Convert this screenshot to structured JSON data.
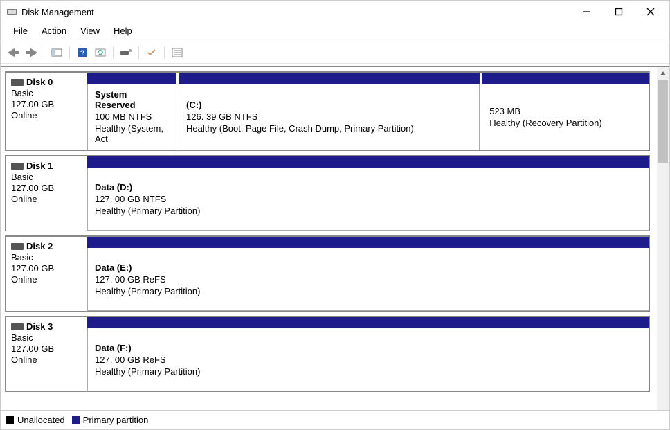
{
  "window": {
    "title": "Disk Management"
  },
  "menu": {
    "file": "File",
    "action": "Action",
    "view": "View",
    "help": "Help"
  },
  "legend": {
    "unallocated": "Unallocated",
    "primary": "Primary partition"
  },
  "disks": [
    {
      "name": "Disk 0",
      "type": "Basic",
      "size": "127.00 GB",
      "status": "Online",
      "partitions": [
        {
          "title": "System Reserved",
          "size": "100 MB NTFS",
          "health": "Healthy (System, Act",
          "width": "16%"
        },
        {
          "title": "(C:)",
          "size": "126. 39 GB NTFS",
          "health": "Healthy (Boot, Page File, Crash Dump, Primary Partition)",
          "width": "54%"
        },
        {
          "title": "",
          "size": "523 MB",
          "health": "Healthy (Recovery Partition)",
          "width": "30%"
        }
      ]
    },
    {
      "name": "Disk 1",
      "type": "Basic",
      "size": "127.00 GB",
      "status": "Online",
      "partitions": [
        {
          "title": "Data (D:)",
          "size": "127. 00 GB NTFS",
          "health": "Healthy (Primary Partition)",
          "width": "100%"
        }
      ]
    },
    {
      "name": "Disk 2",
      "type": "Basic",
      "size": "127.00 GB",
      "status": "Online",
      "partitions": [
        {
          "title": "Data (E:)",
          "size": "127. 00 GB ReFS",
          "health": "Healthy (Primary Partition)",
          "width": "100%"
        }
      ]
    },
    {
      "name": "Disk 3",
      "type": "Basic",
      "size": "127.00 GB",
      "status": "Online",
      "partitions": [
        {
          "title": "Data (F:)",
          "size": "127. 00 GB ReFS",
          "health": "Healthy (Primary Partition)",
          "width": "100%"
        }
      ]
    }
  ]
}
